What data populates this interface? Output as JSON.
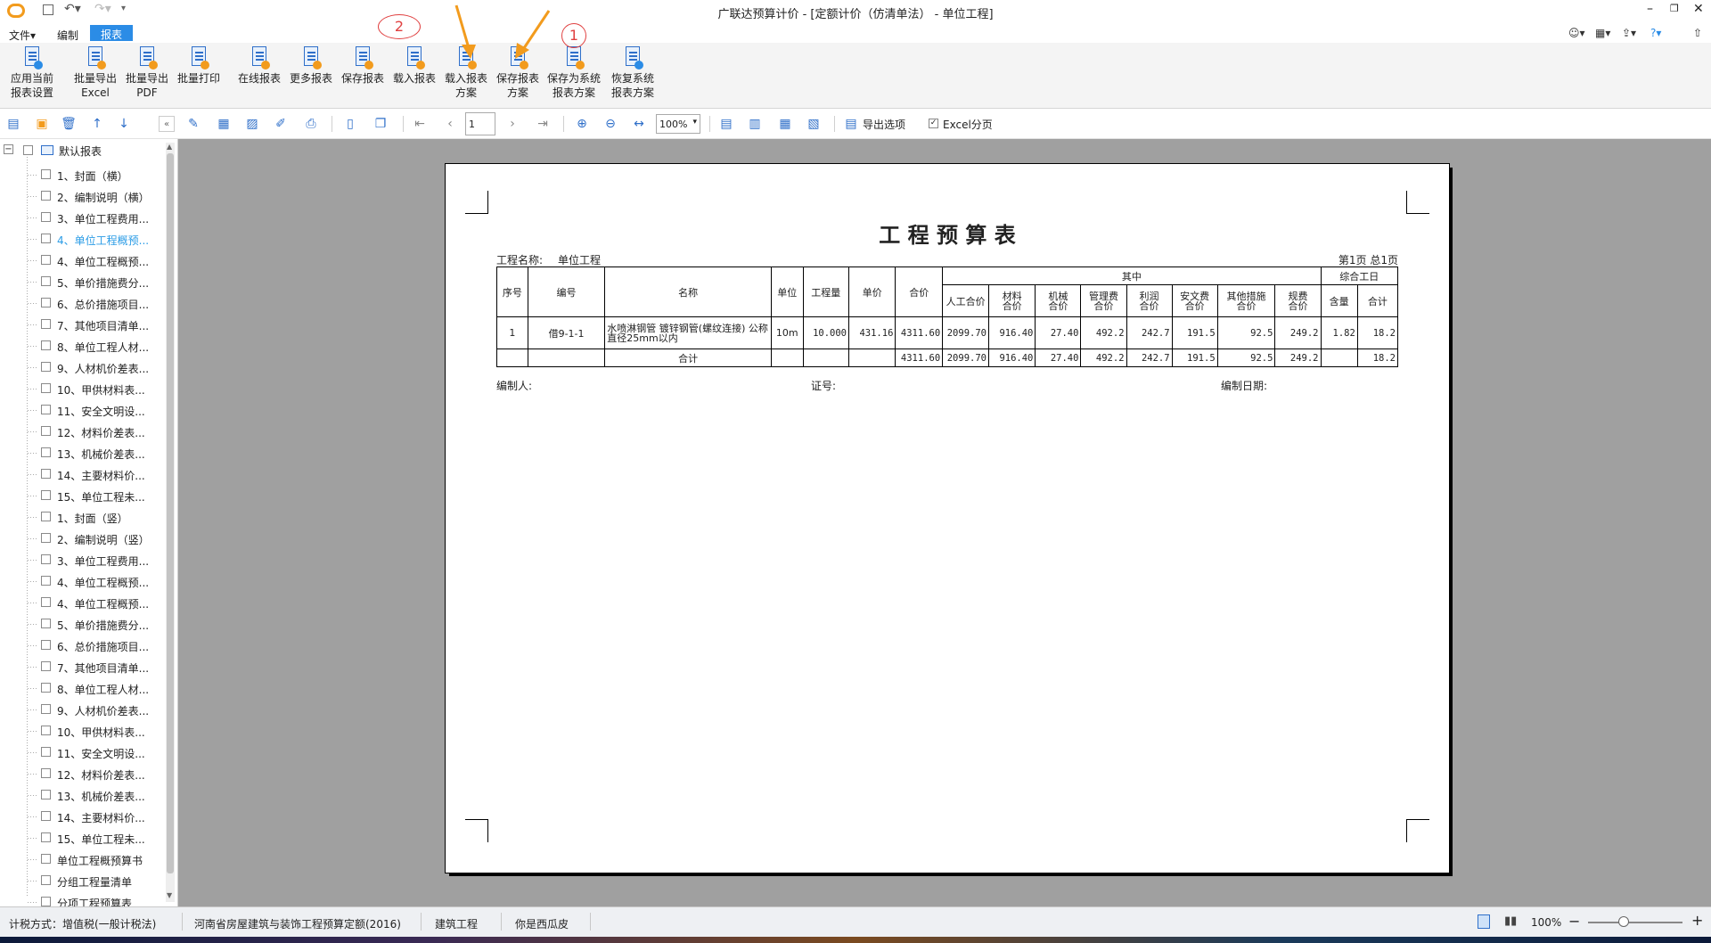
{
  "window": {
    "title": "广联达预算计价 - [定额计价（仿清单法） - 单位工程]",
    "controls": [
      "minimize",
      "restore",
      "close"
    ]
  },
  "menu": {
    "items": [
      "文件▾",
      "编制",
      "报表"
    ],
    "active": "报表"
  },
  "ribbon": {
    "buttons": [
      {
        "line1": "应用当前",
        "line2": "报表设置"
      },
      {
        "line1": "批量导出",
        "line2": "Excel"
      },
      {
        "line1": "批量导出",
        "line2": "PDF"
      },
      {
        "line1": "批量打印",
        "line2": ""
      },
      {
        "line1": "在线报表",
        "line2": ""
      },
      {
        "line1": "更多报表",
        "line2": ""
      },
      {
        "line1": "保存报表",
        "line2": ""
      },
      {
        "line1": "载入报表",
        "line2": ""
      },
      {
        "line1": "载入报表",
        "line2": "方案"
      },
      {
        "line1": "保存报表",
        "line2": "方案"
      },
      {
        "line1": "保存为系统",
        "line2": "报表方案"
      },
      {
        "line1": "恢复系统",
        "line2": "报表方案"
      }
    ],
    "annotations": {
      "circle_2": "2",
      "circle_1": "1"
    }
  },
  "toolbar": {
    "page_input": "1",
    "zoom": "100%",
    "export_options": "导出选项",
    "excel_paging": "Excel分页"
  },
  "sidebar": {
    "root": "默认报表",
    "items": [
      "1、封面（横）",
      "2、编制说明（横）",
      "3、单位工程费用...",
      "4、单位工程概预...",
      "4、单位工程概预...",
      "5、单价措施费分...",
      "6、总价措施项目...",
      "7、其他项目清单...",
      "8、单位工程人材...",
      "9、人材机价差表...",
      "10、甲供材料表...",
      "11、安全文明设...",
      "12、材料价差表...",
      "13、机械价差表...",
      "14、主要材料价...",
      "15、单位工程未...",
      "1、封面（竖）",
      "2、编制说明（竖）",
      "3、单位工程费用...",
      "4、单位工程概预...",
      "4、单位工程概预...",
      "5、单价措施费分...",
      "6、总价措施项目...",
      "7、其他项目清单...",
      "8、单位工程人材...",
      "9、人材机价差表...",
      "10、甲供材料表...",
      "11、安全文明设...",
      "12、材料价差表...",
      "13、机械价差表...",
      "14、主要材料价...",
      "15、单位工程未...",
      "单位工程概预算书",
      "分组工程量清单",
      "分项工程预算表"
    ],
    "selected_index": 3
  },
  "report": {
    "title": "工 程 预 算 表",
    "project_label": "工程名称:",
    "project_name": "单位工程",
    "page_info": "第1页 总1页",
    "headers": {
      "seq": "序号",
      "code": "编号",
      "name": "名称",
      "unit": "单位",
      "qty": "工程量",
      "unit_price": "单价",
      "total": "合价",
      "of_which": "其中",
      "labor": "人工合价",
      "material_1": "材料",
      "material_2": "合价",
      "machine_1": "机械",
      "machine_2": "合价",
      "mgmt_1": "管理费",
      "mgmt_2": "合价",
      "profit_1": "利润",
      "profit_2": "合价",
      "safety_1": "安文费",
      "safety_2": "合价",
      "other_1": "其他措施",
      "other_2": "合价",
      "fee_1": "规费",
      "fee_2": "合价",
      "workday": "综合工日",
      "content": "含量",
      "subtotal": "合计"
    },
    "rows": [
      {
        "seq": "1",
        "code": "借9-1-1",
        "name": "水喷淋钢管 镀锌钢管(螺纹连接) 公称直径25mm以内",
        "unit": "10m",
        "qty": "10.000",
        "unit_price": "431.16",
        "total": "4311.60",
        "labor": "2099.70",
        "material": "916.40",
        "machine": "27.40",
        "mgmt": "492.2",
        "profit": "242.7",
        "safety": "191.5",
        "other": "92.5",
        "fee": "249.2",
        "content": "1.82",
        "subtotal": "18.2"
      }
    ],
    "sum_row": {
      "label": "合计",
      "total": "4311.60",
      "labor": "2099.70",
      "material": "916.40",
      "machine": "27.40",
      "mgmt": "492.2",
      "profit": "242.7",
      "safety": "191.5",
      "other": "92.5",
      "fee": "249.2",
      "subtotal": "18.2"
    },
    "footer": {
      "preparer": "编制人:",
      "cert": "证号:",
      "date": "编制日期:"
    }
  },
  "status": {
    "tax": "计税方式：增值税(一般计税法)",
    "quota": "河南省房屋建筑与装饰工程预算定额(2016)",
    "type": "建筑工程",
    "user": "你是西瓜皮",
    "zoom": "100%"
  }
}
